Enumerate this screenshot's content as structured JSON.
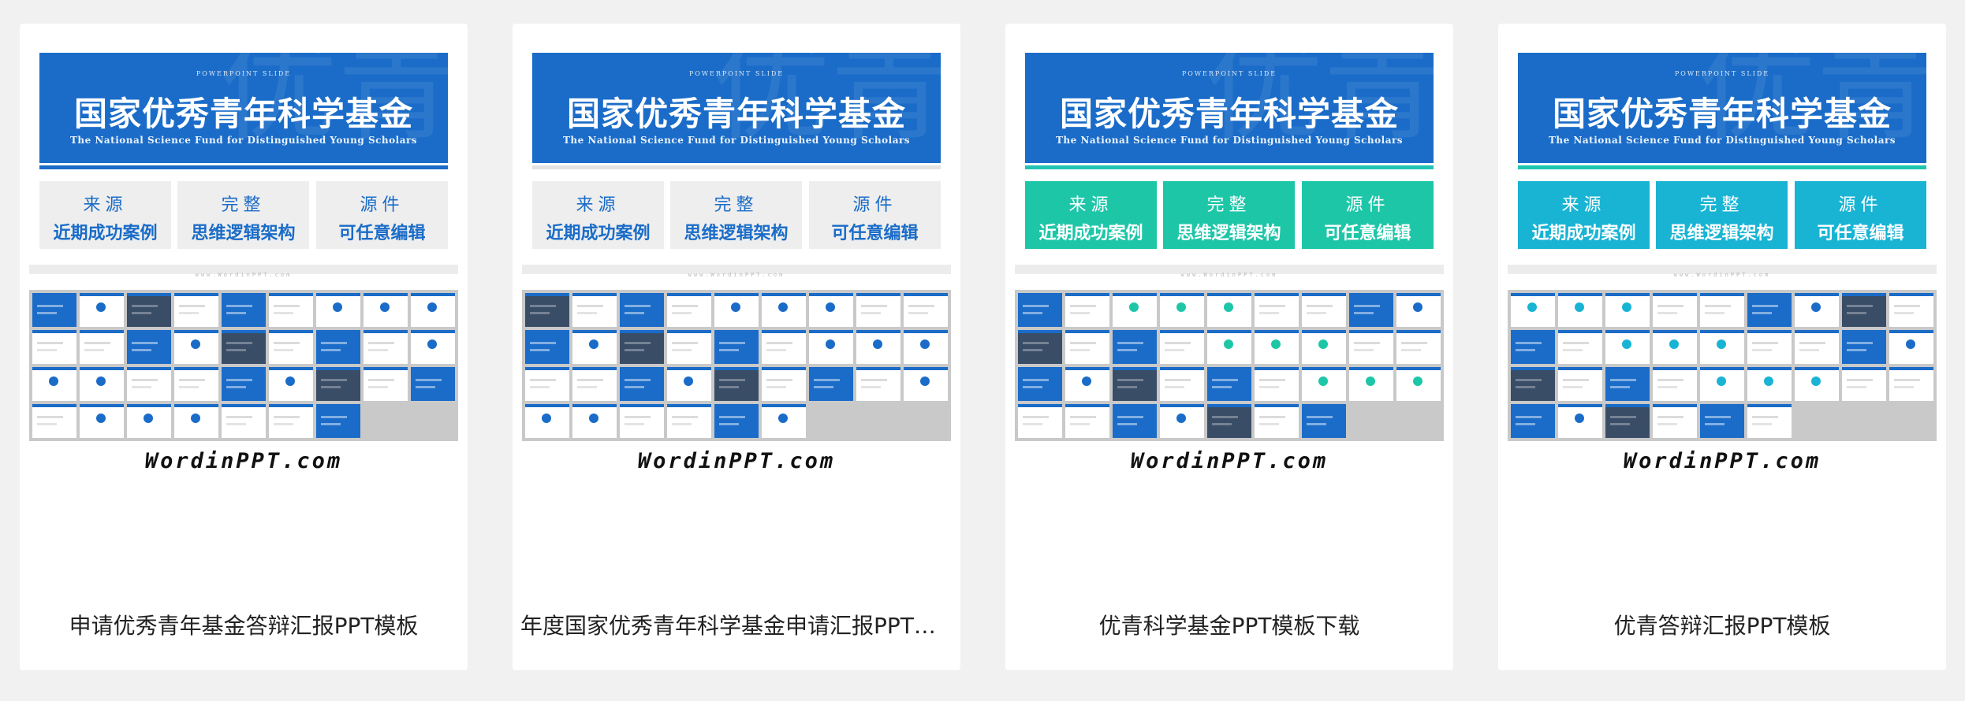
{
  "cards": [
    {
      "banner": {
        "kicker": "POWERPOINT SLIDE",
        "title": "国家优秀青年科学基金",
        "subtitle": "The National Science Fund for Distinguished Young Scholars",
        "ghost": "优青"
      },
      "features": [
        {
          "line1": "来源",
          "line2": "近期成功案例"
        },
        {
          "line1": "完整",
          "line2": "思维逻辑架构"
        },
        {
          "line1": "源件",
          "line2": "可任意编辑"
        }
      ],
      "footer_url": "www.WordinPPT.com",
      "wordmark": "WordinPPT.com",
      "caption": "申请优秀青年基金答辩汇报PPT模板",
      "colors": {
        "banner": "#1a6cc8",
        "underline": "#1a6cc8",
        "feature_bg": "#eeeeee",
        "feature_text": "#1a6cc8",
        "accent": "#1a6cc8"
      }
    },
    {
      "banner": {
        "kicker": "POWERPOINT SLIDE",
        "title": "国家优秀青年科学基金",
        "subtitle": "The National Science Fund for Distinguished Young Scholars",
        "ghost": "优青"
      },
      "features": [
        {
          "line1": "来源",
          "line2": "近期成功案例"
        },
        {
          "line1": "完整",
          "line2": "思维逻辑架构"
        },
        {
          "line1": "源件",
          "line2": "可任意编辑"
        }
      ],
      "footer_url": "www.WordinPPT.com",
      "wordmark": "WordinPPT.com",
      "caption": "年度国家优秀青年科学基金申请汇报PPT模板",
      "colors": {
        "banner": "#1a6cc8",
        "underline": "#e2e2e2",
        "feature_bg": "#eeeeee",
        "feature_text": "#1a6cc8",
        "accent": "#1a6cc8"
      }
    },
    {
      "banner": {
        "kicker": "POWERPOINT SLIDE",
        "title": "国家优秀青年科学基金",
        "subtitle": "The National Science Fund for Distinguished Young Scholars",
        "ghost": "优青"
      },
      "features": [
        {
          "line1": "来源",
          "line2": "近期成功案例"
        },
        {
          "line1": "完整",
          "line2": "思维逻辑架构"
        },
        {
          "line1": "源件",
          "line2": "可任意编辑"
        }
      ],
      "footer_url": "www.WordinPPT.com",
      "wordmark": "WordinPPT.com",
      "caption": "优青科学基金PPT模板下载",
      "colors": {
        "banner": "#1a6cc8",
        "underline": "#20c4b4",
        "feature_bg": "#1ec6a8",
        "feature_text": "#ffffff",
        "accent": "#1a6cc8"
      }
    },
    {
      "banner": {
        "kicker": "POWERPOINT SLIDE",
        "title": "国家优秀青年科学基金",
        "subtitle": "The National Science Fund for Distinguished Young Scholars",
        "ghost": "优青"
      },
      "features": [
        {
          "line1": "来源",
          "line2": "近期成功案例"
        },
        {
          "line1": "完整",
          "line2": "思维逻辑架构"
        },
        {
          "line1": "源件",
          "line2": "可任意编辑"
        }
      ],
      "footer_url": "www.WordinPPT.com",
      "wordmark": "WordinPPT.com",
      "caption": "优青答辩汇报PPT模板",
      "colors": {
        "banner": "#1a6cc8",
        "underline": "#1ec6b0",
        "feature_bg": "#19b4d4",
        "feature_text": "#ffffff",
        "accent": "#1a6cc8"
      }
    }
  ]
}
